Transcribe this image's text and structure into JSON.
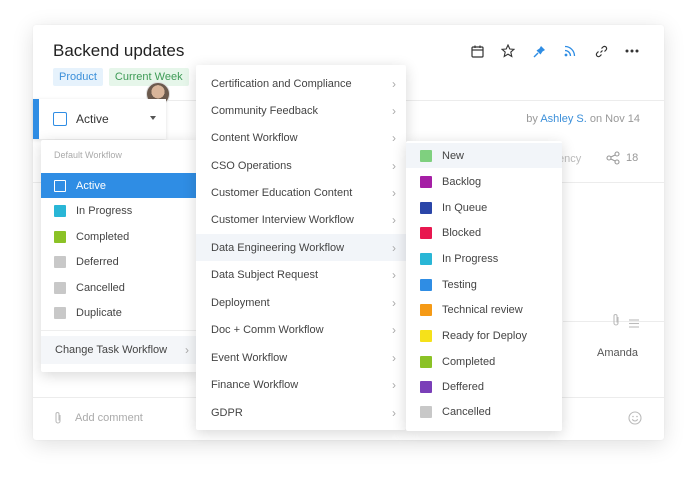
{
  "task": {
    "title": "Backend updates",
    "tags": [
      "Product",
      "Current Week"
    ],
    "byline_prefix": "by",
    "author": "Ashley S.",
    "byline_suffix": "on Nov 14",
    "partial_text": "ency",
    "share_count": "18",
    "assignee": "Amanda",
    "comment_placeholder": "Add comment"
  },
  "toolbar_icons": [
    "calendar-icon",
    "star-icon",
    "pin-icon",
    "rss-icon",
    "link-icon",
    "more-icon"
  ],
  "status": {
    "current": "Active",
    "menu_header": "Default Workflow",
    "options": [
      {
        "label": "Active",
        "color": "#2f8de4",
        "selected": true
      },
      {
        "label": "In Progress",
        "color": "#29b6d6"
      },
      {
        "label": "Completed",
        "color": "#8bc226"
      },
      {
        "label": "Deferred",
        "color": "#c8c8c8"
      },
      {
        "label": "Cancelled",
        "color": "#c8c8c8"
      },
      {
        "label": "Duplicate",
        "color": "#c8c8c8"
      }
    ],
    "change_workflow": "Change Task Workflow"
  },
  "workflows": [
    "Certification and Compliance",
    "Community Feedback",
    "Content Workflow",
    "CSO Operations",
    "Customer Education Content",
    "Customer Interview Workflow",
    "Data Engineering Workflow",
    "Data Subject Request",
    "Deployment",
    "Doc + Comm Workflow",
    "Event Workflow",
    "Finance Workflow",
    "GDPR"
  ],
  "workflow_statuses": [
    {
      "label": "New",
      "color": "#7fd07f"
    },
    {
      "label": "Backlog",
      "color": "#a51fa5"
    },
    {
      "label": "In Queue",
      "color": "#2a45a8"
    },
    {
      "label": "Blocked",
      "color": "#e8174f"
    },
    {
      "label": "In Progress",
      "color": "#29b6d6"
    },
    {
      "label": "Testing",
      "color": "#2f8de4"
    },
    {
      "label": "Technical review",
      "color": "#f59a16"
    },
    {
      "label": "Ready for Deploy",
      "color": "#f5e11a"
    },
    {
      "label": "Completed",
      "color": "#8bc226"
    },
    {
      "label": "Deffered",
      "color": "#7a3fb8"
    },
    {
      "label": "Cancelled",
      "color": "#c8c8c8"
    }
  ]
}
